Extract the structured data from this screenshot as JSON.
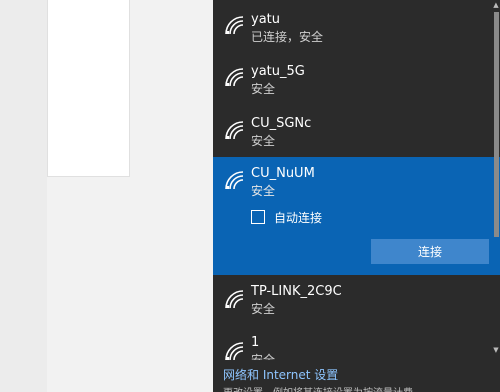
{
  "networks": [
    {
      "name": "yatu",
      "status": "已连接，安全"
    },
    {
      "name": "yatu_5G",
      "status": "安全"
    },
    {
      "name": "CU_SGNc",
      "status": "安全"
    },
    {
      "name": "CU_NuUM",
      "status": "安全",
      "auto_connect_label": "自动连接",
      "connect_label": "连接"
    },
    {
      "name": "TP-LINK_2C9C",
      "status": "安全"
    },
    {
      "name": "1",
      "status": "安全"
    }
  ],
  "footer": {
    "settings_link": "网络和 Internet 设置",
    "hint": "更改设置，例如将某连接设置为按流量计费。"
  },
  "icons": {
    "network": "wifi-secured-icon",
    "scroll_up": "chevron-up-icon",
    "scroll_down": "chevron-down-icon"
  },
  "colors": {
    "flyout_bg": "#2b2b2b",
    "selected_bg": "#0a64b4",
    "button_bg": "#3f86cc",
    "link": "#8ec5ff"
  }
}
